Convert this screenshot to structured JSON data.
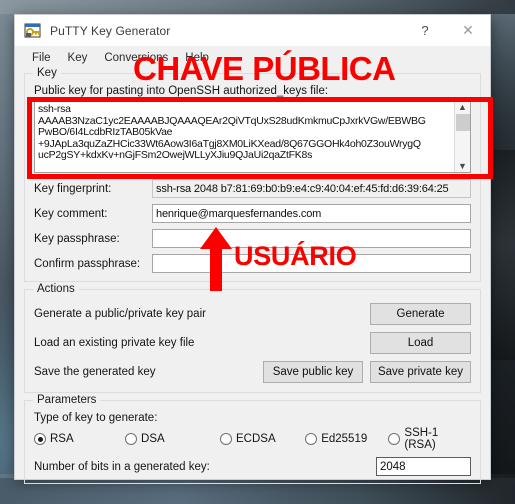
{
  "window": {
    "title": "PuTTY Key Generator",
    "icon": "putty-key-icon",
    "help_button": "?",
    "close_button": "✕"
  },
  "menubar": {
    "items": [
      {
        "label": "File",
        "name": "menu-file"
      },
      {
        "label": "Key",
        "name": "menu-key"
      },
      {
        "label": "Conversions",
        "name": "menu-conversions"
      },
      {
        "label": "Help",
        "name": "menu-help"
      }
    ]
  },
  "key_group": {
    "legend": "Key",
    "public_key_caption": "Public key for pasting into OpenSSH authorized_keys file:",
    "public_key_text": "ssh-rsa\nAAAAB3NzaC1yc2EAAAABJQAAAQEAr2QiVTqUxS28udKmkmuCpJxrkVGw/EBWBG\nPwBO/6I4LcdbRIzTAB05kVae\n+9JApLa3quZaZHCic33Wt6Aow3I6aTgj8XM0LiKXead/8Q67GGOHk4oh0Z3ouWrygQ\nucP2gSY+kdxKv+nGjFSm2OwejWLLyXJiu9QJaUi2qaZtFK8s",
    "scroll_up_icon": "▲",
    "scroll_down_icon": "▼",
    "fields": [
      {
        "label": "Key fingerprint:",
        "name": "key-fingerprint",
        "value": "ssh-rsa 2048 b7:81:69:b0:b9:e4:c9:40:04:ef:45:fd:d6:39:64:25",
        "readonly": true
      },
      {
        "label": "Key comment:",
        "name": "key-comment",
        "value": "henrique@marquesfernandes.com",
        "readonly": false
      },
      {
        "label": "Key passphrase:",
        "name": "key-passphrase",
        "value": "",
        "readonly": false
      },
      {
        "label": "Confirm passphrase:",
        "name": "confirm-passphrase",
        "value": "",
        "readonly": false
      }
    ]
  },
  "actions_group": {
    "legend": "Actions",
    "rows": [
      {
        "description": "Generate a public/private key pair",
        "buttons": [
          {
            "label": "Generate",
            "name": "generate-button"
          }
        ]
      },
      {
        "description": "Load an existing private key file",
        "buttons": [
          {
            "label": "Load",
            "name": "load-button"
          }
        ]
      },
      {
        "description": "Save the generated key",
        "buttons": [
          {
            "label": "Save public key",
            "name": "save-public-key-button"
          },
          {
            "label": "Save private key",
            "name": "save-private-key-button"
          }
        ]
      }
    ]
  },
  "parameters_group": {
    "legend": "Parameters",
    "type_caption": "Type of key to generate:",
    "key_types": [
      {
        "label": "RSA",
        "selected": true
      },
      {
        "label": "DSA",
        "selected": false
      },
      {
        "label": "ECDSA",
        "selected": false
      },
      {
        "label": "Ed25519",
        "selected": false
      },
      {
        "label": "SSH-1 (RSA)",
        "selected": false
      }
    ],
    "bits_caption": "Number of bits in a generated key:",
    "bits_value": "2048"
  },
  "annotations": {
    "color": "#fc0000",
    "title_text": "CHAVE PÚBLICA",
    "user_text": "USUÁRIO",
    "arrow": "up-arrow-annotation",
    "rectangle": "public-key-highlight-rectangle"
  }
}
